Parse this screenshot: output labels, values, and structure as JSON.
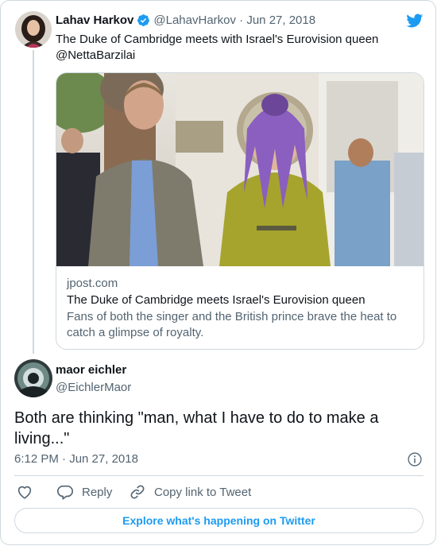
{
  "tweet": {
    "author_name": "Lahav Harkov",
    "author_handle": "@LahavHarkov",
    "separator": "·",
    "date": "Jun 27, 2018",
    "text_line1": "The Duke of Cambridge meets with Israel's Eurovision queen",
    "text_line2": "@NettaBarzilai",
    "verified": true
  },
  "link_card": {
    "domain": "jpost.com",
    "title": "The Duke of Cambridge meets Israel's Eurovision queen",
    "description": "Fans of both the singer and the British prince brave the heat to catch a glimpse of royalty."
  },
  "reply": {
    "author_name": "maor eichler",
    "author_handle": "@EichlerMaor",
    "text": "Both are thinking \"man, what I have to do to make a living...\"",
    "timestamp": "6:12 PM · Jun 27, 2018"
  },
  "actions": {
    "reply_label": "Reply",
    "copy_link_label": "Copy link to Tweet"
  },
  "explore_label": "Explore what's happening on Twitter",
  "colors": {
    "twitter_blue": "#1d9bf0",
    "text_primary": "#0f1419",
    "text_secondary": "#536471",
    "border": "#cfd9de"
  },
  "icons": [
    "verified-badge-icon",
    "twitter-bird-icon",
    "info-icon",
    "heart-icon",
    "reply-bubble-icon",
    "link-icon"
  ]
}
